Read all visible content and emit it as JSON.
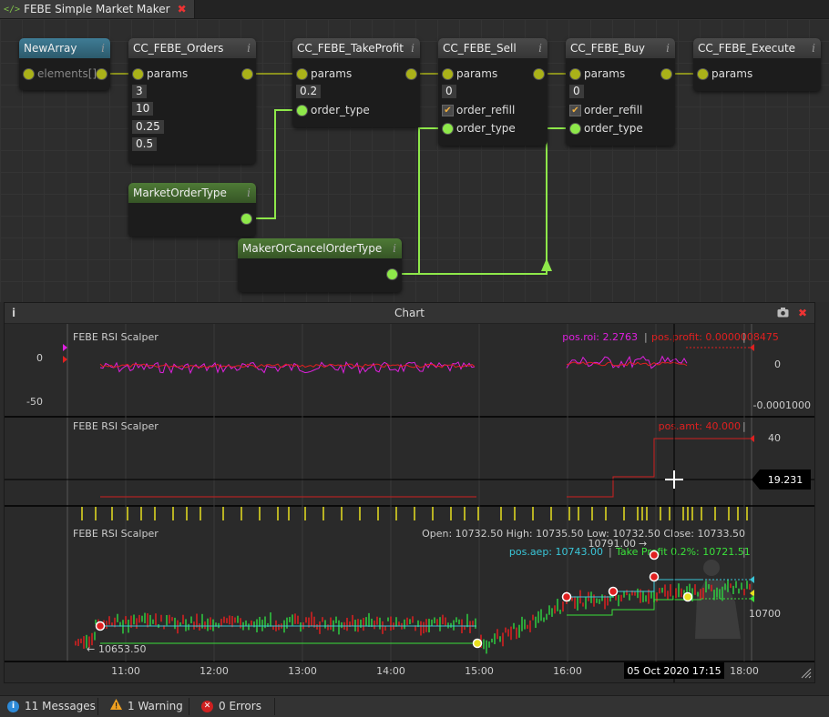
{
  "tab": {
    "icon": "</>",
    "title": "FEBE Simple Market Maker",
    "close": "✖"
  },
  "nodes": {
    "newarray": {
      "title": "NewArray",
      "port": "elements[]"
    },
    "orders": {
      "title": "CC_FEBE_Orders",
      "port": "params",
      "values": [
        "3",
        "10",
        "0.25",
        "0.5"
      ]
    },
    "takeprofit": {
      "title": "CC_FEBE_TakeProfit",
      "port": "params",
      "value": "0.2",
      "port2": "order_type"
    },
    "sell": {
      "title": "CC_FEBE_Sell",
      "port": "params",
      "value": "0",
      "refill": "order_refill",
      "port2": "order_type"
    },
    "buy": {
      "title": "CC_FEBE_Buy",
      "port": "params",
      "value": "0",
      "refill": "order_refill",
      "port2": "order_type"
    },
    "execute": {
      "title": "CC_FEBE_Execute",
      "port": "params"
    },
    "market": {
      "title": "MarketOrderType"
    },
    "makercancel": {
      "title": "MakerOrCancelOrderType"
    },
    "info": "i"
  },
  "chart_window": {
    "title": "Chart",
    "info": "i",
    "camera_icon": "camera-icon",
    "close": "✖"
  },
  "chart_data": [
    {
      "type": "line",
      "panel": "roi",
      "name": "FEBE RSI Scalper",
      "legend": {
        "roi_label": "pos.roi: 2.2763",
        "profit_label": "pos.profit: 0.0000008475",
        "sep": "|",
        "sep2": "|"
      },
      "left_ticks": [
        "0",
        "-50"
      ],
      "right_ticks": [
        "0",
        "-0.0001000"
      ],
      "colors": {
        "roi": "#e020e0",
        "profit": "#e02020"
      }
    },
    {
      "type": "line",
      "panel": "amount",
      "name": "FEBE RSI Scalper",
      "legend": {
        "amt_label": "pos.amt: 40.000",
        "sep": "|"
      },
      "right_ticks": [
        "40"
      ],
      "crosshair_value": "19.231",
      "colors": {
        "amt": "#d02020"
      }
    },
    {
      "type": "candlestick",
      "panel": "price",
      "name": "FEBE RSI Scalper",
      "ohlc": "Open: 10732.50  High: 10735.50  Low: 10732.50  Close: 10733.50",
      "aep_label": "pos.aep: 10743.00",
      "tp_label": "Take Profit 0.2%: 10721.51",
      "sep": "|",
      "sep2": "|",
      "right_ticks": [
        "10700"
      ],
      "annotations": {
        "low": "10653.50",
        "high": "10791.00"
      },
      "x_ticks": [
        "11:00",
        "12:00",
        "13:00",
        "14:00",
        "15:00",
        "16:00",
        "17:00",
        "18:00"
      ],
      "crosshair_time": "05 Oct 2020 17:15",
      "colors": {
        "aep": "#3ac6d8",
        "tp": "#3ae03a",
        "up": "#2ecc40",
        "down": "#e02020",
        "markers": "#e8e020"
      }
    }
  ],
  "status": {
    "messages": "11 Messages",
    "warnings": "1 Warning",
    "errors": "0 Errors"
  }
}
